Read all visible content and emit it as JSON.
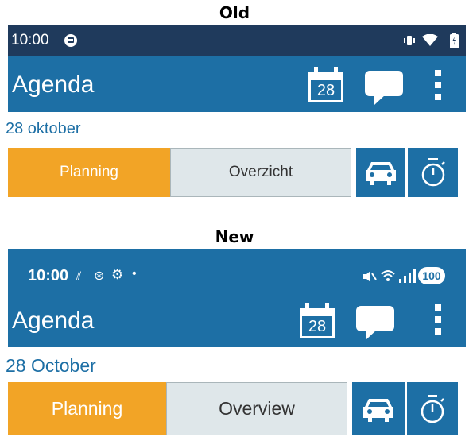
{
  "old": {
    "heading": "Old",
    "status": {
      "time": "10:00"
    },
    "appbar": {
      "title": "Agenda",
      "calendar_day": "28"
    },
    "date": "28 oktober",
    "tabs": {
      "planning": "Planning",
      "overview": "Overzicht"
    }
  },
  "new": {
    "heading": "New",
    "status": {
      "time": "10:00",
      "battery": "100"
    },
    "appbar": {
      "title": "Agenda",
      "calendar_day": "28"
    },
    "date": "28 October",
    "tabs": {
      "planning": "Planning",
      "overview": "Overview"
    }
  },
  "colors": {
    "appbar": "#1d6fa5",
    "status_old": "#1f3a5c",
    "active_tab": "#f2a426",
    "inactive_tab": "#dfe7ea"
  },
  "icons": [
    "calendar-icon",
    "chat-icon",
    "more-vert-icon",
    "car-icon",
    "timer-icon"
  ]
}
